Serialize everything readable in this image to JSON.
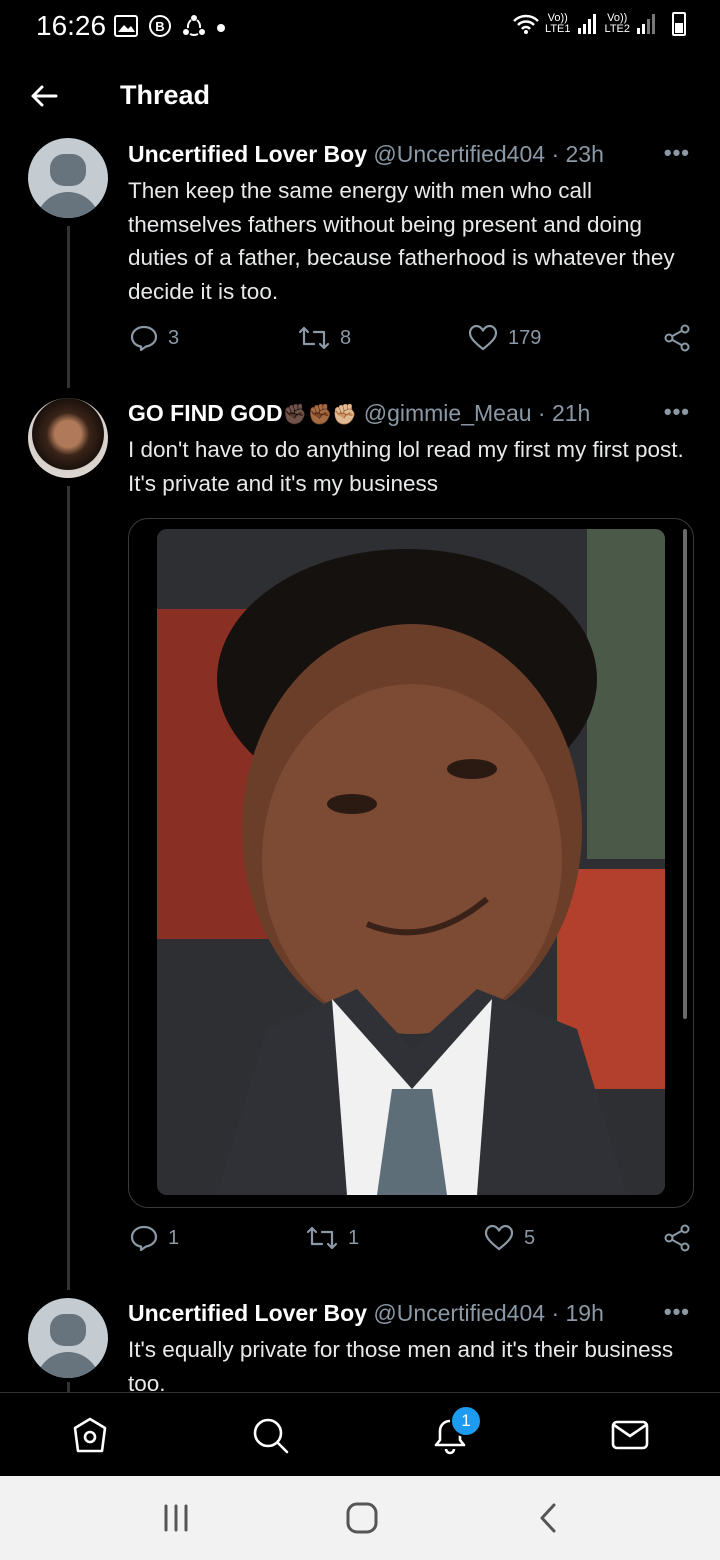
{
  "status_bar": {
    "time": "16:26",
    "left_icons": [
      "gallery-icon",
      "b-badge-icon",
      "sync-icon",
      "dot-icon"
    ],
    "network1_label_top": "Vo))",
    "network1_label_bottom": "LTE1",
    "network2_label_top": "Vo))",
    "network2_label_bottom": "LTE2"
  },
  "header": {
    "title": "Thread"
  },
  "tweets": [
    {
      "name": "Uncertified Lover Boy",
      "handle_time": "@Uncertified404 · 23h",
      "text": "Then keep the same energy with men who call themselves fathers without being present and doing duties of a father, because fatherhood is whatever they decide it is too.",
      "replies": "3",
      "retweets": "8",
      "likes": "179"
    },
    {
      "name": "GO FIND GOD",
      "name_emoji": "✊🏿✊🏾✊🏼",
      "handle_time": "@gimmie_Meau · 21h",
      "text": "I don't have to do anything lol read my first my first post. It's private and it's my business",
      "replies": "1",
      "retweets": "1",
      "likes": "5"
    },
    {
      "name": "Uncertified Lover Boy",
      "handle_time": "@Uncertified404 · 19h",
      "text": "It's equally private for those men and it's their business too."
    }
  ],
  "bottom_nav": {
    "items": [
      "home-icon",
      "search-icon",
      "notifications-icon",
      "messages-icon"
    ],
    "notification_count": "1"
  },
  "colors": {
    "background": "#000000",
    "secondary_text": "#8b98a5",
    "accent": "#1d9bf0"
  }
}
